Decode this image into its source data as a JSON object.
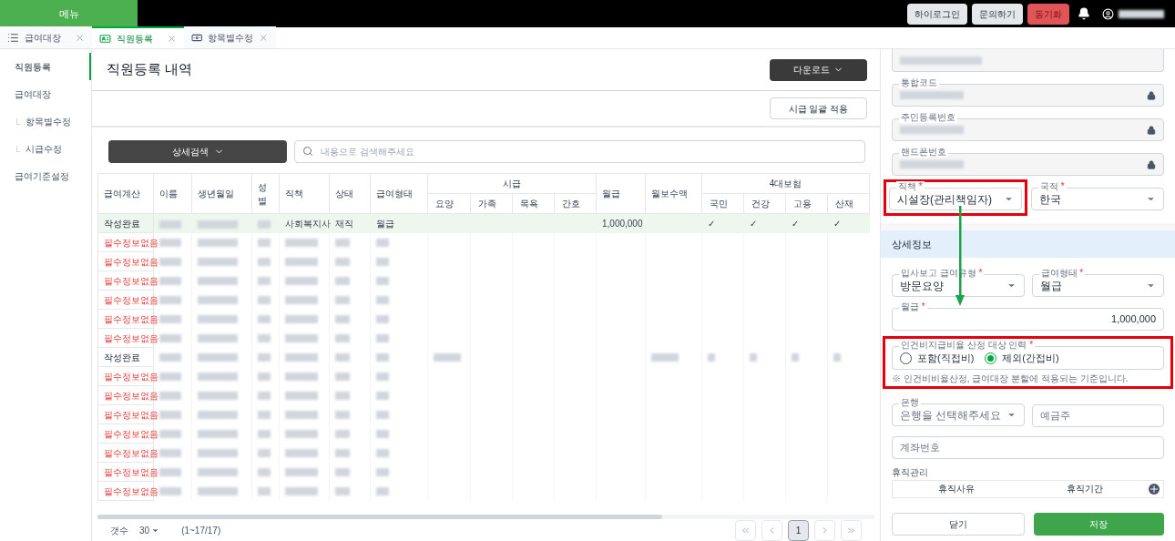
{
  "top_bar": {
    "menu": "메뉴",
    "buttons": [
      {
        "label": "하이로그인",
        "kind": "default"
      },
      {
        "label": "문의하기",
        "kind": "default"
      },
      {
        "label": "동기화",
        "kind": "danger"
      }
    ]
  },
  "tabs": [
    {
      "label": "급여대장",
      "selected": false
    },
    {
      "label": "직원등록",
      "selected": true
    },
    {
      "label": "항목별수정",
      "selected": false
    }
  ],
  "sidebar": {
    "items": [
      {
        "label": "직원등록",
        "selected": true
      },
      {
        "label": "급여대장",
        "selected": false,
        "children": [
          {
            "label": "항목별수정",
            "selected": false
          },
          {
            "label": "시급수정",
            "selected": false
          }
        ]
      },
      {
        "label": "급여기준설정",
        "selected": false
      }
    ]
  },
  "main": {
    "title": "직원등록 내역",
    "download": "다운로드",
    "bulk_apply": "시급 일괄 적용",
    "detail_search": "상세검색",
    "search": {
      "placeholder": "내용으로 검색해주세요"
    }
  },
  "table": {
    "columns": [
      {
        "label": "급여계산"
      },
      {
        "label": "이름"
      },
      {
        "label": "생년월일"
      },
      {
        "label": "성별"
      },
      {
        "label": "직책"
      },
      {
        "label": "상태"
      },
      {
        "label": "급여형태"
      },
      {
        "label": "시급",
        "colspan": 4,
        "children": [
          {
            "label": "요양"
          },
          {
            "label": "가족"
          },
          {
            "label": "목욕"
          },
          {
            "label": "간호"
          }
        ]
      },
      {
        "label": "월급"
      },
      {
        "label": "월보수액"
      },
      {
        "label": "4대보험",
        "colspan": 4,
        "children": [
          {
            "label": "국민"
          },
          {
            "label": "건강"
          },
          {
            "label": "고용"
          },
          {
            "label": "산재"
          }
        ]
      }
    ],
    "rows": [
      {
        "kind": "complete",
        "selected": true,
        "cells": [
          {
            "text": "작성완료"
          },
          {
            "redacted": true
          },
          {
            "redacted": true
          },
          {
            "redacted": true
          },
          {
            "text": "사회복지사"
          },
          {
            "text": "재직"
          },
          {
            "text": "월급"
          },
          {
            "redacted": false
          },
          {
            "redacted": false
          },
          {
            "redacted": false
          },
          {
            "redacted": false
          },
          {
            "text": "1,000,000"
          },
          {
            "redacted": false
          },
          {
            "text": "✓"
          },
          {
            "text": "✓"
          },
          {
            "text": "✓"
          },
          {
            "text": "✓"
          }
        ]
      },
      {
        "kind": "missing",
        "selected": false,
        "cells": [
          {
            "text": "필수정보없음"
          },
          {
            "redacted": true
          },
          {
            "redacted": true
          },
          {
            "redacted": true
          },
          {
            "redacted": true
          },
          {
            "redacted": true
          },
          {
            "redacted": true
          },
          {
            "redacted": false
          },
          {
            "redacted": false
          },
          {
            "redacted": false
          },
          {
            "redacted": false
          },
          {
            "redacted": false
          },
          {
            "redacted": false
          },
          {
            "redacted": false
          },
          {
            "redacted": false
          },
          {
            "redacted": false
          },
          {
            "redacted": false
          }
        ]
      },
      {
        "kind": "missing",
        "selected": false,
        "cells": [
          {
            "text": "필수정보없음"
          },
          {
            "redacted": true
          },
          {
            "redacted": true
          },
          {
            "redacted": true
          },
          {
            "redacted": true
          },
          {
            "redacted": true
          },
          {
            "redacted": true
          },
          {
            "redacted": false
          },
          {
            "redacted": false
          },
          {
            "redacted": false
          },
          {
            "redacted": false
          },
          {
            "redacted": false
          },
          {
            "redacted": false
          },
          {
            "redacted": false
          },
          {
            "redacted": false
          },
          {
            "redacted": false
          },
          {
            "redacted": false
          }
        ]
      },
      {
        "kind": "missing",
        "selected": false,
        "cells": [
          {
            "text": "필수정보없음"
          },
          {
            "redacted": true
          },
          {
            "redacted": true
          },
          {
            "redacted": true
          },
          {
            "redacted": true
          },
          {
            "redacted": true
          },
          {
            "redacted": true
          },
          {
            "redacted": false
          },
          {
            "redacted": false
          },
          {
            "redacted": false
          },
          {
            "redacted": false
          },
          {
            "redacted": false
          },
          {
            "redacted": false
          },
          {
            "redacted": false
          },
          {
            "redacted": false
          },
          {
            "redacted": false
          },
          {
            "redacted": false
          }
        ]
      },
      {
        "kind": "missing",
        "selected": false,
        "cells": [
          {
            "text": "필수정보없음"
          },
          {
            "redacted": true
          },
          {
            "redacted": true
          },
          {
            "redacted": true
          },
          {
            "redacted": true
          },
          {
            "redacted": true
          },
          {
            "redacted": true
          },
          {
            "redacted": false
          },
          {
            "redacted": false
          },
          {
            "redacted": false
          },
          {
            "redacted": false
          },
          {
            "redacted": false
          },
          {
            "redacted": false
          },
          {
            "redacted": false
          },
          {
            "redacted": false
          },
          {
            "redacted": false
          },
          {
            "redacted": false
          }
        ]
      },
      {
        "kind": "missing",
        "selected": false,
        "cells": [
          {
            "text": "필수정보없음"
          },
          {
            "redacted": true
          },
          {
            "redacted": true
          },
          {
            "redacted": true
          },
          {
            "redacted": true
          },
          {
            "redacted": true
          },
          {
            "redacted": true
          },
          {
            "redacted": false
          },
          {
            "redacted": false
          },
          {
            "redacted": false
          },
          {
            "redacted": false
          },
          {
            "redacted": false
          },
          {
            "redacted": false
          },
          {
            "redacted": false
          },
          {
            "redacted": false
          },
          {
            "redacted": false
          },
          {
            "redacted": false
          }
        ]
      },
      {
        "kind": "missing",
        "selected": false,
        "cells": [
          {
            "text": "필수정보없음"
          },
          {
            "redacted": true
          },
          {
            "redacted": true
          },
          {
            "redacted": true
          },
          {
            "redacted": true
          },
          {
            "redacted": true
          },
          {
            "redacted": true
          },
          {
            "redacted": false
          },
          {
            "redacted": false
          },
          {
            "redacted": false
          },
          {
            "redacted": false
          },
          {
            "redacted": false
          },
          {
            "redacted": false
          },
          {
            "redacted": false
          },
          {
            "redacted": false
          },
          {
            "redacted": false
          },
          {
            "redacted": false
          }
        ]
      },
      {
        "kind": "complete",
        "selected": false,
        "cells": [
          {
            "text": "작성완료"
          },
          {
            "redacted": true
          },
          {
            "redacted": true
          },
          {
            "redacted": true
          },
          {
            "redacted": true
          },
          {
            "redacted": true
          },
          {
            "redacted": true
          },
          {
            "redacted": true
          },
          {
            "redacted": false
          },
          {
            "redacted": false
          },
          {
            "redacted": false
          },
          {
            "redacted": false
          },
          {
            "redacted": true
          },
          {
            "redacted": true
          },
          {
            "redacted": true
          },
          {
            "redacted": true
          },
          {
            "redacted": true
          }
        ]
      },
      {
        "kind": "missing",
        "selected": false,
        "cells": [
          {
            "text": "필수정보없음"
          },
          {
            "redacted": true
          },
          {
            "redacted": true
          },
          {
            "redacted": true
          },
          {
            "redacted": true
          },
          {
            "redacted": true
          },
          {
            "redacted": true
          },
          {
            "redacted": false
          },
          {
            "redacted": false
          },
          {
            "redacted": false
          },
          {
            "redacted": false
          },
          {
            "redacted": false
          },
          {
            "redacted": false
          },
          {
            "redacted": false
          },
          {
            "redacted": false
          },
          {
            "redacted": false
          },
          {
            "redacted": false
          }
        ]
      },
      {
        "kind": "missing",
        "selected": false,
        "cells": [
          {
            "text": "필수정보없음"
          },
          {
            "redacted": true
          },
          {
            "redacted": true
          },
          {
            "redacted": true
          },
          {
            "redacted": true
          },
          {
            "redacted": true
          },
          {
            "redacted": true
          },
          {
            "redacted": false
          },
          {
            "redacted": false
          },
          {
            "redacted": false
          },
          {
            "redacted": false
          },
          {
            "redacted": false
          },
          {
            "redacted": false
          },
          {
            "redacted": false
          },
          {
            "redacted": false
          },
          {
            "redacted": false
          },
          {
            "redacted": false
          }
        ]
      },
      {
        "kind": "missing",
        "selected": false,
        "cells": [
          {
            "text": "필수정보없음"
          },
          {
            "redacted": true
          },
          {
            "redacted": true
          },
          {
            "redacted": true
          },
          {
            "redacted": true
          },
          {
            "redacted": true
          },
          {
            "redacted": true
          },
          {
            "redacted": false
          },
          {
            "redacted": false
          },
          {
            "redacted": false
          },
          {
            "redacted": false
          },
          {
            "redacted": false
          },
          {
            "redacted": false
          },
          {
            "redacted": false
          },
          {
            "redacted": false
          },
          {
            "redacted": false
          },
          {
            "redacted": false
          }
        ]
      },
      {
        "kind": "missing",
        "selected": false,
        "cells": [
          {
            "text": "필수정보없음"
          },
          {
            "redacted": true
          },
          {
            "redacted": true
          },
          {
            "redacted": true
          },
          {
            "redacted": true
          },
          {
            "redacted": true
          },
          {
            "redacted": true
          },
          {
            "redacted": false
          },
          {
            "redacted": false
          },
          {
            "redacted": false
          },
          {
            "redacted": false
          },
          {
            "redacted": false
          },
          {
            "redacted": false
          },
          {
            "redacted": false
          },
          {
            "redacted": false
          },
          {
            "redacted": false
          },
          {
            "redacted": false
          }
        ]
      },
      {
        "kind": "missing",
        "selected": false,
        "cells": [
          {
            "text": "필수정보없음"
          },
          {
            "redacted": true
          },
          {
            "redacted": true
          },
          {
            "redacted": true
          },
          {
            "redacted": true
          },
          {
            "redacted": true
          },
          {
            "redacted": true
          },
          {
            "redacted": false
          },
          {
            "redacted": false
          },
          {
            "redacted": false
          },
          {
            "redacted": false
          },
          {
            "redacted": false
          },
          {
            "redacted": false
          },
          {
            "redacted": false
          },
          {
            "redacted": false
          },
          {
            "redacted": false
          },
          {
            "redacted": false
          }
        ]
      },
      {
        "kind": "missing",
        "selected": false,
        "cells": [
          {
            "text": "필수정보없음"
          },
          {
            "redacted": true
          },
          {
            "redacted": true
          },
          {
            "redacted": true
          },
          {
            "redacted": true
          },
          {
            "redacted": true
          },
          {
            "redacted": true
          },
          {
            "redacted": false
          },
          {
            "redacted": false
          },
          {
            "redacted": false
          },
          {
            "redacted": false
          },
          {
            "redacted": false
          },
          {
            "redacted": false
          },
          {
            "redacted": false
          },
          {
            "redacted": false
          },
          {
            "redacted": false
          },
          {
            "redacted": false
          }
        ]
      },
      {
        "kind": "missing",
        "selected": false,
        "cells": [
          {
            "text": "필수정보없음"
          },
          {
            "redacted": true
          },
          {
            "redacted": true
          },
          {
            "redacted": true
          },
          {
            "redacted": true
          },
          {
            "redacted": true
          },
          {
            "redacted": true
          },
          {
            "redacted": false
          },
          {
            "redacted": false
          },
          {
            "redacted": false
          },
          {
            "redacted": false
          },
          {
            "redacted": false
          },
          {
            "redacted": false
          },
          {
            "redacted": false
          },
          {
            "redacted": false
          },
          {
            "redacted": false
          },
          {
            "redacted": false
          }
        ]
      }
    ]
  },
  "footer": {
    "count_label": "갯수",
    "page_size": "30",
    "range": "(1~17/17)",
    "pages": [
      {
        "label": "1",
        "selected": true
      }
    ]
  },
  "employee_form": {
    "fields": [
      {
        "kind": "text"
      },
      {
        "label": "통합코드",
        "kind": "locked"
      },
      {
        "label": "주민등록번호",
        "kind": "locked"
      },
      {
        "label": "핸드폰번호",
        "kind": "locked"
      }
    ],
    "position": {
      "label": "직책",
      "required": "*",
      "value": "시설장(관리책임자)",
      "highlighted": true
    },
    "nationality": {
      "label": "국적",
      "required": "*",
      "value": "한국"
    }
  },
  "detail": {
    "title": "상세정보",
    "report_pay_type": {
      "label": "입사보고 급여유형",
      "required": "*",
      "value": "방문요양"
    },
    "pay_type": {
      "label": "급여형태",
      "required": "*",
      "value": "월급"
    },
    "monthly": {
      "label": "월급",
      "required": "*",
      "value": "1,000,000"
    },
    "cost_target": {
      "label": "인건비지급비율 산정 대상 인력",
      "required": "*",
      "highlighted": true,
      "options": [
        {
          "label": "포함(직접비)",
          "selected": false
        },
        {
          "label": "제외(간접비)",
          "selected": true
        }
      ],
      "note": "※ 인건비비율산정, 급여대장 분할에 적용되는 기준입니다."
    },
    "bank": {
      "label": "은행",
      "placeholder": "은행을 선택해주세요"
    },
    "holder": {
      "placeholder": "예금주"
    },
    "account": {
      "placeholder": "계좌번호"
    },
    "leave": {
      "title": "휴직관리",
      "columns": [
        "휴직사유",
        "휴직기간"
      ]
    },
    "buttons": [
      {
        "label": "닫기",
        "kind": "default"
      },
      {
        "label": "저장",
        "kind": "primary"
      }
    ]
  }
}
